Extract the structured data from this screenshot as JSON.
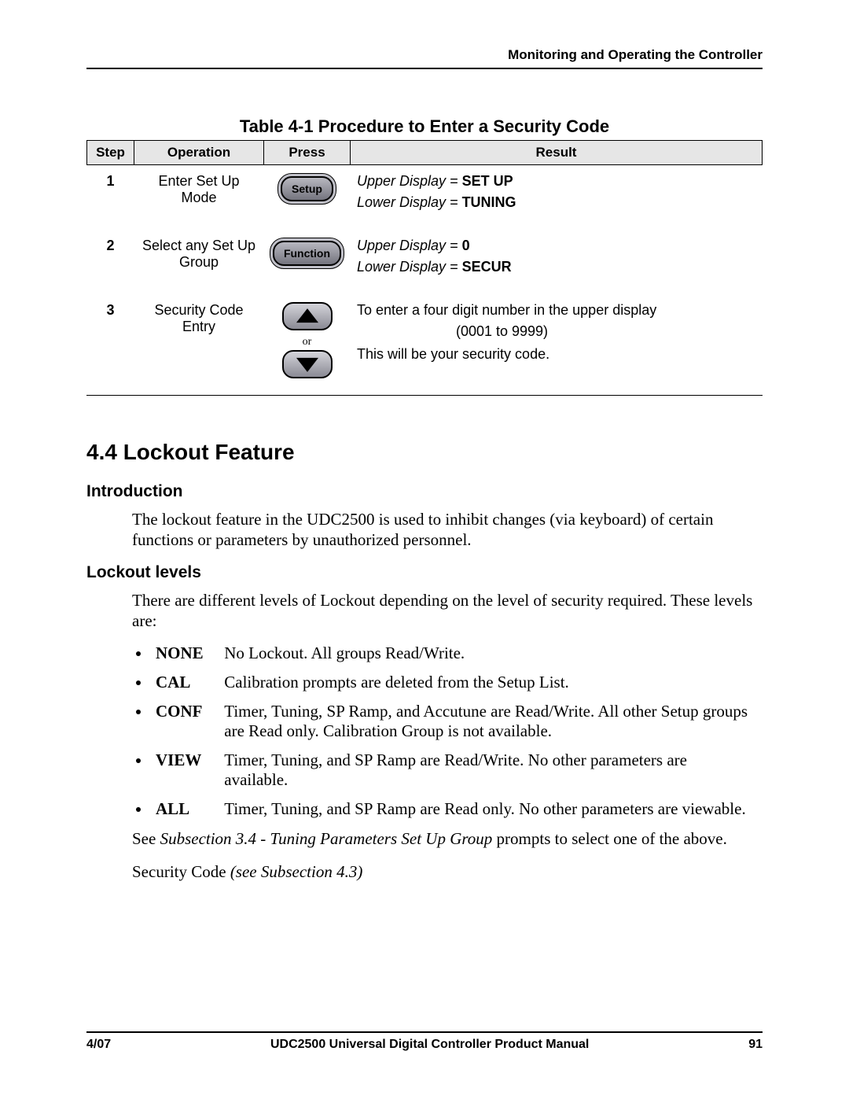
{
  "header": {
    "chapter_title": "Monitoring and Operating the Controller"
  },
  "table": {
    "caption": "Table 4-1  Procedure to Enter a Security Code",
    "columns": {
      "step": "Step",
      "operation": "Operation",
      "press": "Press",
      "result": "Result"
    },
    "rows": [
      {
        "step": "1",
        "operation": "Enter Set Up Mode",
        "press_label": "Setup",
        "result_upper_prefix": "Upper Display = ",
        "result_upper_value": "SET UP",
        "result_lower_prefix": "Lower Display = ",
        "result_lower_value": "TUNING"
      },
      {
        "step": "2",
        "operation": "Select any Set Up Group",
        "press_label": "Function",
        "result_upper_prefix": "Upper Display = ",
        "result_upper_value": "0",
        "result_lower_prefix": "Lower Display = ",
        "result_lower_value": "SECUR"
      },
      {
        "step": "3",
        "operation": "Security Code Entry",
        "or_label": "or",
        "result_line1": "To enter a four digit number in the upper display",
        "result_line1b": "(0001 to 9999)",
        "result_line2": "This will be your security code."
      }
    ]
  },
  "section": {
    "heading": "4.4  Lockout Feature",
    "intro_heading": "Introduction",
    "intro_text": "The lockout feature in the UDC2500 is used to inhibit changes (via keyboard) of certain functions or parameters by unauthorized personnel.",
    "levels_heading": "Lockout levels",
    "levels_intro": "There are different levels of Lockout depending on the level of security required. These levels are:",
    "levels": [
      {
        "label": "NONE",
        "desc": "No Lockout. All groups Read/Write."
      },
      {
        "label": "CAL",
        "desc": "Calibration prompts are deleted from the Setup List."
      },
      {
        "label": "CONF",
        "desc": "Timer, Tuning, SP Ramp, and Accutune are Read/Write. All other Setup groups are Read only. Calibration Group is not available."
      },
      {
        "label": "VIEW",
        "desc": " Timer, Tuning, and SP Ramp are Read/Write. No other parameters are available."
      },
      {
        "label": "ALL",
        "desc": "Timer, Tuning, and SP Ramp are Read only. No other parameters are viewable."
      }
    ],
    "see_prefix": "See ",
    "see_ref": "Subsection 3.4  - Tuning Parameters Set Up Group",
    "see_suffix": " prompts to select one of the above.",
    "sec_code_prefix": "Security Code ",
    "sec_code_ref": "(see Subsection 4.3)"
  },
  "footer": {
    "date": "4/07",
    "title": "UDC2500 Universal Digital Controller Product Manual",
    "page": "91"
  }
}
